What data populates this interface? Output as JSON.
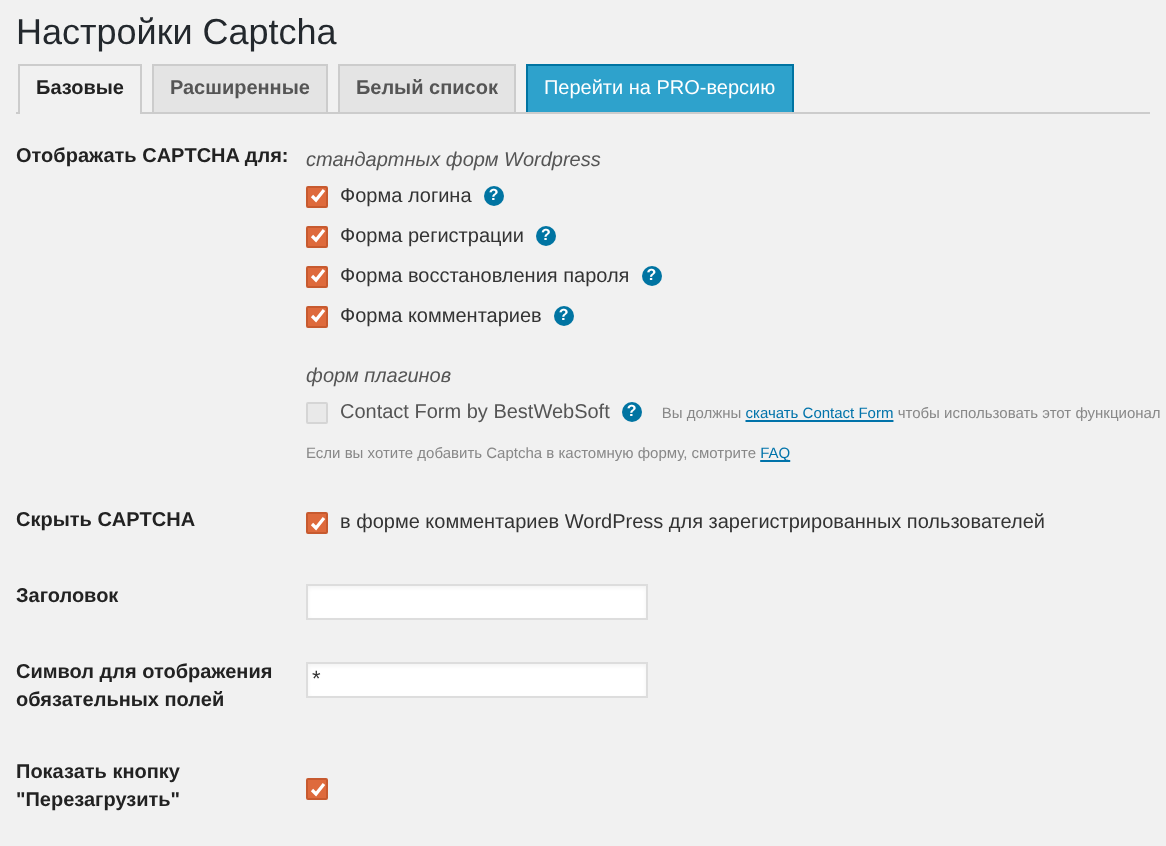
{
  "page_title": "Настройки Captcha",
  "tabs": [
    {
      "label": "Базовые",
      "selected": true,
      "kind": "tab"
    },
    {
      "label": "Расширенные",
      "selected": false,
      "kind": "tab"
    },
    {
      "label": "Белый список",
      "selected": false,
      "kind": "tab"
    },
    {
      "label": "Перейти на PRO-версию",
      "selected": false,
      "kind": "promo"
    }
  ],
  "settings": [
    {
      "label": "Отображать CAPTCHA для:",
      "kind": "groups",
      "groups": [
        {
          "heading": "стандартных форм Wordpress",
          "options": [
            {
              "label": "Форма логина",
              "checked": true,
              "disabled": false,
              "help": "?"
            },
            {
              "label": "Форма регистрации",
              "checked": true,
              "disabled": false,
              "help": "?"
            },
            {
              "label": "Форма восстановления пароля",
              "checked": true,
              "disabled": false,
              "help": "?"
            },
            {
              "label": "Форма комментариев",
              "checked": true,
              "disabled": false,
              "help": "?"
            }
          ]
        },
        {
          "heading": "форм плагинов",
          "options": [
            {
              "label": "Contact Form by BestWebSoft",
              "checked": false,
              "disabled": true,
              "help": "?",
              "note": {
                "before": "Вы должны",
                "link": "скачать Contact Form",
                "after": "чтобы использовать этот функционал"
              }
            }
          ]
        }
      ],
      "footnote": {
        "text": "Если вы хотите добавить Captcha в кастомную форму, смотрите",
        "link": "FAQ"
      }
    },
    {
      "label": "Скрыть CAPTCHA",
      "kind": "checkbox",
      "checked": true,
      "text": "в форме комментариев WordPress для зарегистрированных пользователей"
    },
    {
      "label": "Заголовок",
      "kind": "input"
    },
    {
      "label": "Символ для отображения обязательных полей",
      "kind": "input",
      "value": "*"
    },
    {
      "label": "Показать кнопку \"Перезагрузить\"",
      "kind": "checkbox",
      "checked": true
    }
  ]
}
